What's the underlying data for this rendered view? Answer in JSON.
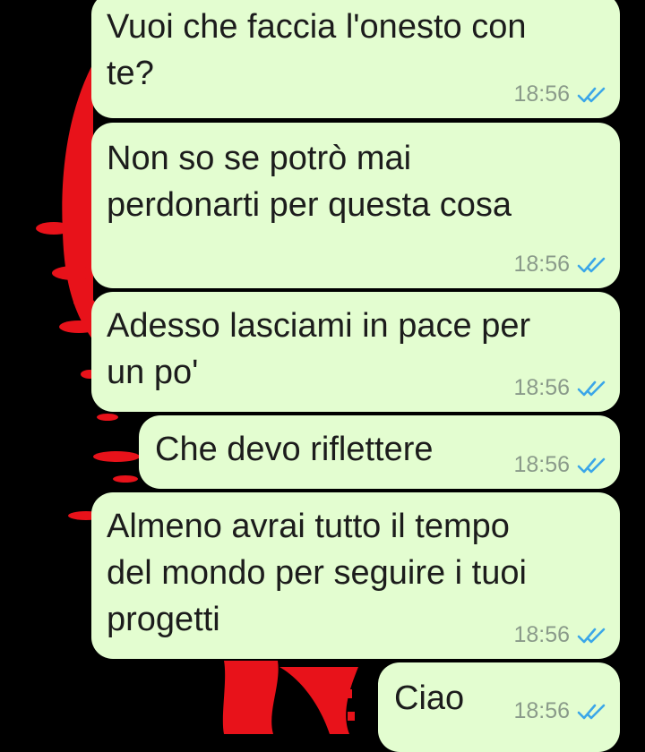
{
  "chat": {
    "messages": [
      {
        "text": "Vuoi che faccia l'onesto con\nte?",
        "time": "18:56",
        "status_icon": "double-check-read-icon"
      },
      {
        "text": "Non so se potrò mai\nperdonarti per questa cosa",
        "time": "18:56",
        "status_icon": "double-check-read-icon"
      },
      {
        "text": "Adesso lasciami in pace per\nun po'",
        "time": "18:56",
        "status_icon": "double-check-read-icon"
      },
      {
        "text": "Che devo riflettere",
        "time": "18:56",
        "status_icon": "double-check-read-icon"
      },
      {
        "text": "Almeno avrai tutto il tempo\ndel mondo per seguire i tuoi\nprogetti",
        "time": "18:56",
        "status_icon": "double-check-read-icon"
      },
      {
        "text": "Ciao",
        "time": "18:56",
        "status_icon": "double-check-read-icon"
      }
    ]
  },
  "colors": {
    "background": "#000000",
    "wallpaper_accent": "#e8121a",
    "bubble": "#e3fdd0",
    "timestamp": "#8a9a8a",
    "read_check": "#3ba6e8"
  }
}
